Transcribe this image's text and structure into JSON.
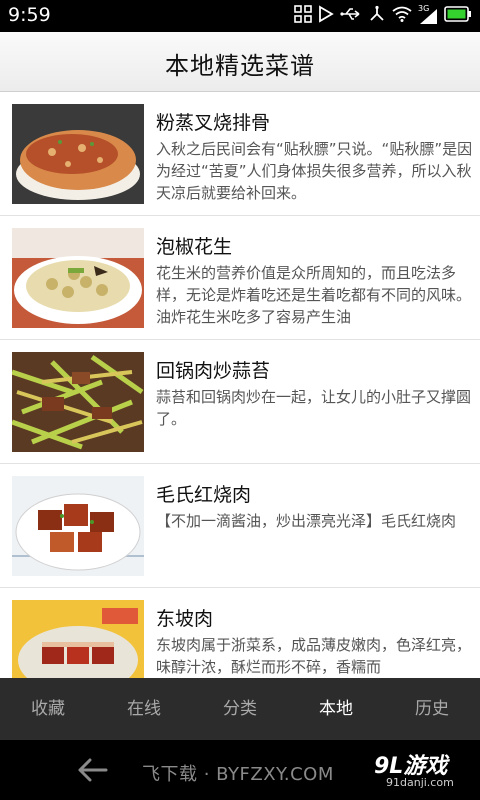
{
  "status_bar": {
    "time": "9:59",
    "icons": [
      "qr-icon",
      "play-icon",
      "usb-icon",
      "debug-icon",
      "wifi-icon",
      "signal-icon",
      "battery-icon"
    ],
    "signal_label": "3G"
  },
  "header": {
    "title": "本地精选菜谱"
  },
  "recipes": [
    {
      "title": "粉蒸叉烧排骨",
      "desc": "入秋之后民间会有“贴秋膘”只说。“贴秋膘”是因为经过“苦夏”人们身体损失很多营养，所以入秋天凉后就要给补回来。",
      "thumb_colors": [
        "#b5502a",
        "#d98a4a",
        "#f3efe6"
      ]
    },
    {
      "title": "泡椒花生",
      "desc": "花生米的营养价值是众所周知的，而且吃法多样，无论是炸着吃还是生着吃都有不同的风味。油炸花生米吃多了容易产生油",
      "thumb_colors": [
        "#e8dcae",
        "#c8b26a",
        "#ffffff"
      ]
    },
    {
      "title": "回锅肉炒蒜苔",
      "desc": "蒜苔和回锅肉炒在一起，让女儿的小肚子又撑圆了。",
      "thumb_colors": [
        "#9cb83a",
        "#7a3a20",
        "#d8c65a"
      ]
    },
    {
      "title": "毛氏红烧肉",
      "desc": "【不加一滴酱油，炒出漂亮光泽】毛氏红烧肉",
      "thumb_colors": [
        "#8a2e14",
        "#c05a2a",
        "#eef2f5"
      ]
    },
    {
      "title": "东坡肉",
      "desc": "东坡肉属于浙菜系，成品薄皮嫩肉，色泽红亮，味醇汁浓，酥烂而形不碎，香糯而",
      "thumb_colors": [
        "#a0281a",
        "#f2c23a",
        "#e9e4d8"
      ]
    }
  ],
  "tabs": [
    {
      "label": "收藏",
      "active": false
    },
    {
      "label": "在线",
      "active": false
    },
    {
      "label": "分类",
      "active": false
    },
    {
      "label": "本地",
      "active": true
    },
    {
      "label": "历史",
      "active": false
    }
  ],
  "watermark": {
    "site_text": "飞下载 · BYFZXY.COM",
    "logo_text": "9L游戏",
    "logo_sub": "91danji.com"
  },
  "colors": {
    "tabbar_bg": "#2c2c2c",
    "tab_active": "#ffffff",
    "tab_inactive": "#a9a9a9",
    "battery": "#35d12e"
  }
}
